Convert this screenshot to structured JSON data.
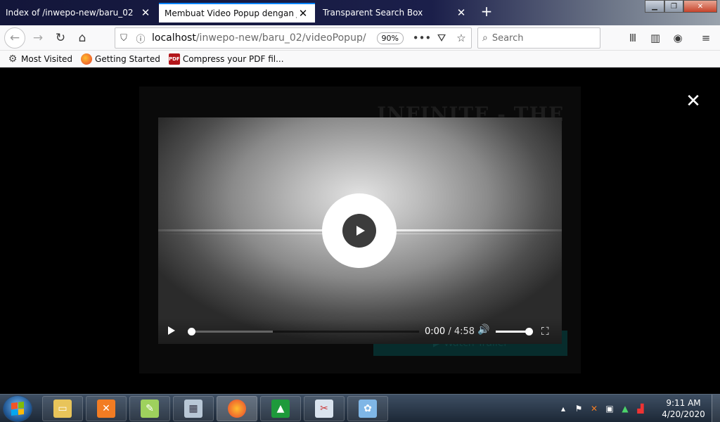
{
  "browser": {
    "tabs": [
      {
        "label": "Index of /inwepo-new/baru_02",
        "active": false
      },
      {
        "label": "Membuat Video Popup dengan JavaScript",
        "active": true
      },
      {
        "label": "Transparent Search Box",
        "active": false
      }
    ],
    "new_tab_label": "+",
    "url_host": "localhost",
    "url_path": "/inwepo-new/baru_02/videoPopup/",
    "zoom": "90%",
    "search_placeholder": "Search",
    "bookmarks": [
      {
        "label": "Most Visited",
        "icon": "gear-icon"
      },
      {
        "label": "Getting Started",
        "icon": "firefox-icon"
      },
      {
        "label": "Compress your PDF fil...",
        "icon": "pdf-icon"
      }
    ],
    "pdf_badge": "PDF"
  },
  "page": {
    "background_title": "INFINITE - THE",
    "background_button": "▶ Watch Trailer"
  },
  "video": {
    "current_time": "0:00",
    "separator": "/",
    "duration": "4:58",
    "progress": 0.0,
    "buffered": 0.36,
    "volume": 1.0
  },
  "taskbar": {
    "time": "9:11 AM",
    "date": "4/20/2020"
  },
  "colors": {
    "tab_accent": "#0a84ff",
    "page_bg": "#000000",
    "button_teal": "#072c2c"
  }
}
